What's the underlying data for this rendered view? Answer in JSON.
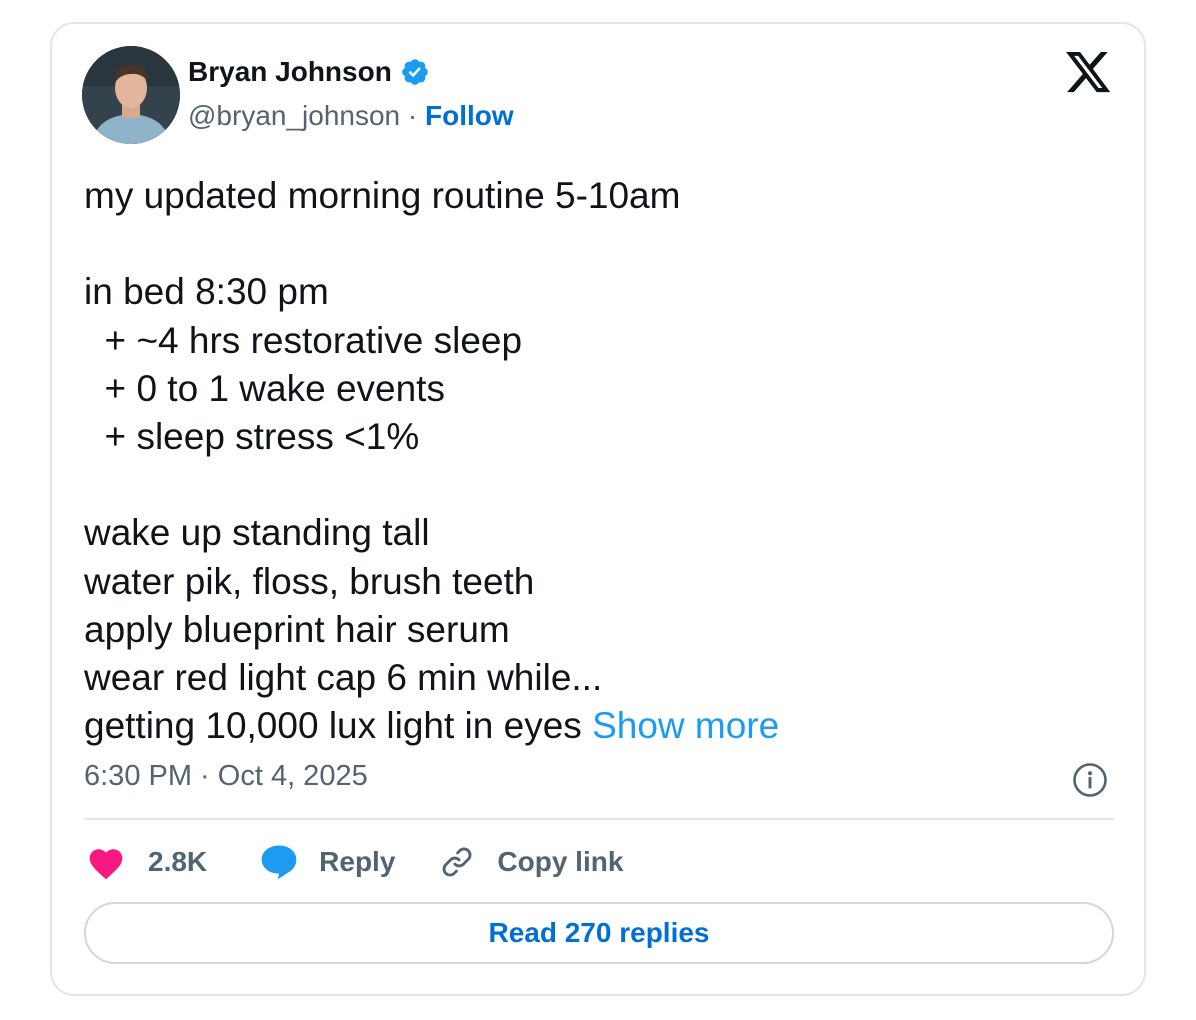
{
  "author": {
    "name": "Bryan Johnson",
    "handle": "@bryan_johnson",
    "separator": "·",
    "follow_label": "Follow",
    "verified": true
  },
  "tweet": {
    "lines": [
      "my updated morning routine 5-10am",
      "",
      "in bed 8:30 pm",
      "  + ~4 hrs restorative sleep",
      "  + 0 to 1 wake events",
      "  + sleep stress <1%",
      "",
      "wake up standing tall",
      "water pik, floss, brush teeth",
      "apply blueprint hair serum",
      "wear red light cap 6 min while...",
      "getting 10,000 lux light in eyes"
    ],
    "show_more_label": "Show more",
    "timestamp": "6:30 PM · Oct 4, 2025"
  },
  "actions": {
    "likes_count": "2.8K",
    "reply_label": "Reply",
    "copy_link_label": "Copy link"
  },
  "read_replies_label": "Read 270 replies",
  "icons": {
    "brand": "x-logo-icon",
    "verified": "verified-badge-icon",
    "info": "info-icon",
    "like": "heart-icon",
    "reply": "speech-bubble-icon",
    "copy": "link-icon"
  },
  "colors": {
    "link_blue": "#1d9bf0",
    "follow_blue": "#006fd6",
    "heart_pink": "#f91880",
    "muted": "#536471",
    "text": "#0f1419"
  }
}
